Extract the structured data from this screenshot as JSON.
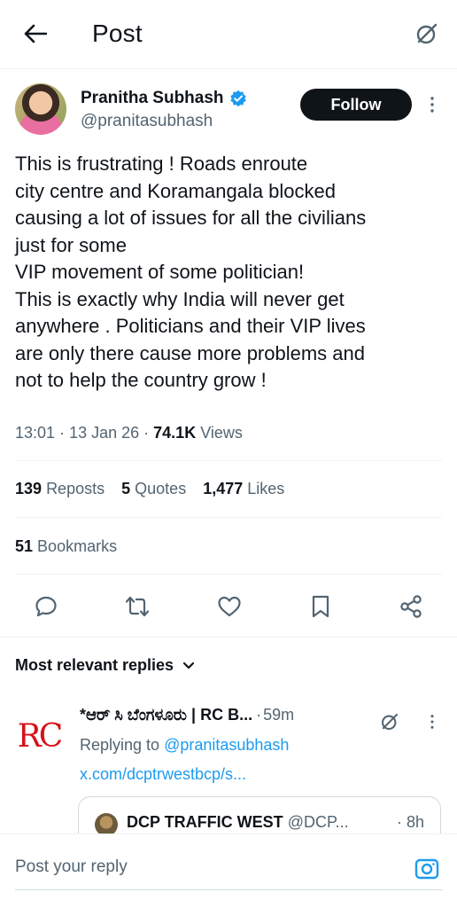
{
  "header": {
    "title": "Post"
  },
  "post": {
    "author_name": "Pranitha Subhash",
    "author_handle": "@pranitasubhash",
    "follow_label": "Follow",
    "text_lines": [
      "This is frustrating ! Roads enroute",
      "city centre and Koramangala blocked",
      "causing a lot of issues for all the civilians",
      "just for some",
      "VIP movement of some politician!",
      "This is exactly why India will never get",
      "anywhere . Politicians and their VIP lives",
      "are only there cause more problems and",
      "not to help the country grow !"
    ],
    "time": "13:01",
    "date": "13 Jan 26",
    "views_count": "74.1K",
    "views_label": "Views",
    "reposts_count": "139",
    "reposts_label": "Reposts",
    "quotes_count": "5",
    "quotes_label": "Quotes",
    "likes_count": "1,477",
    "likes_label": "Likes",
    "bookmarks_count": "51",
    "bookmarks_label": "Bookmarks"
  },
  "actions": [
    "reply-icon",
    "repost-icon",
    "like-icon",
    "bookmark-icon",
    "share-icon"
  ],
  "replies_sort": {
    "label": "Most relevant replies"
  },
  "reply": {
    "avatar_text": "RC",
    "name": "*ಆರ್ ಸಿ ಬೆಂಗಳೂರು | RC B...",
    "time": "59m",
    "replying_prefix": "Replying to",
    "replying_mention": "@pranitasubhash",
    "link": "x.com/dcptrwestbcp/s...",
    "quote": {
      "name": "DCP TRAFFIC WEST",
      "handle": "@DCP...",
      "time": "8h"
    }
  },
  "composer": {
    "placeholder": "Post your reply"
  },
  "colors": {
    "accent": "#1d9bf0",
    "text": "#0f1419",
    "muted": "#536471",
    "follow_bg": "#0f1419"
  }
}
